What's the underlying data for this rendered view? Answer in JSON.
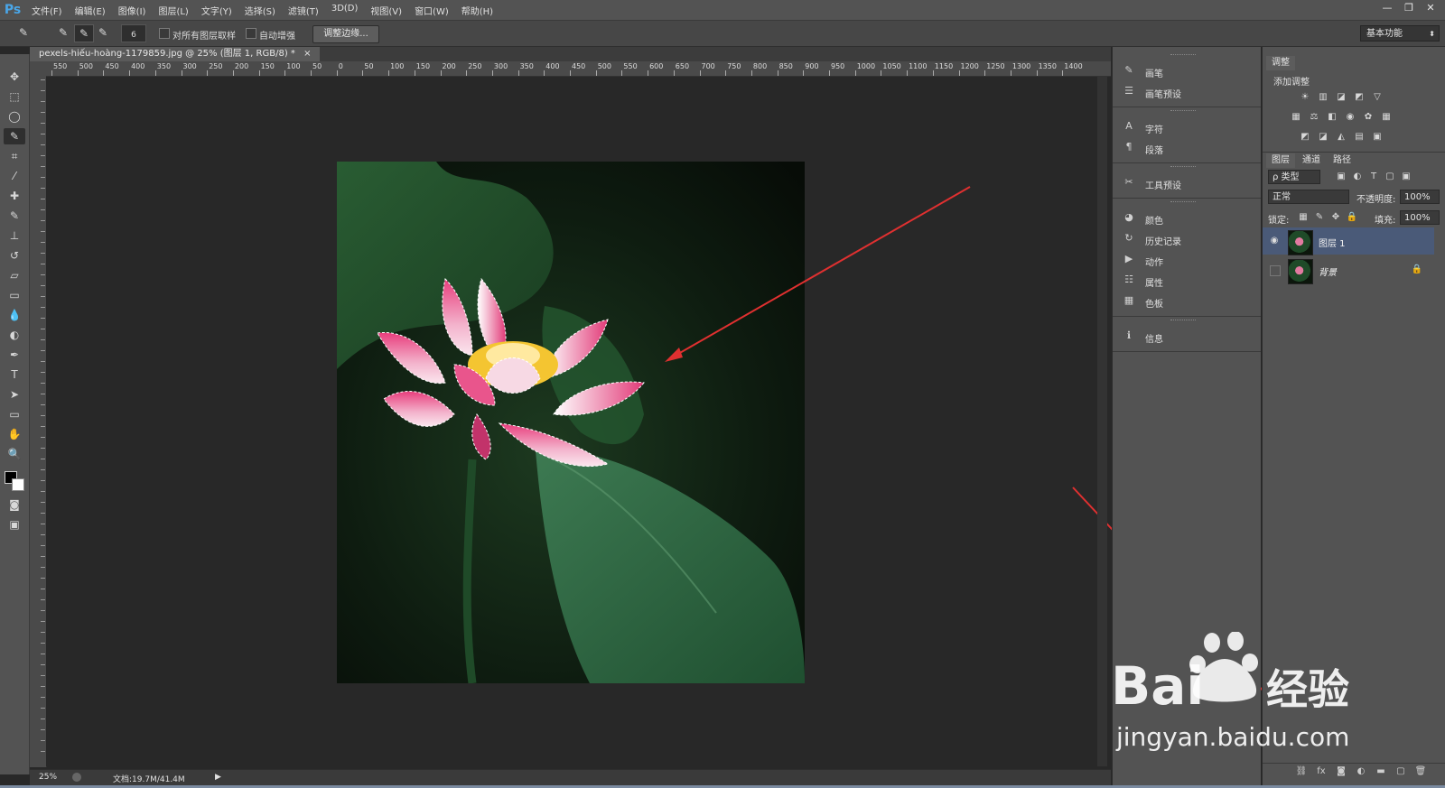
{
  "app": {
    "logo": "Ps",
    "menu": [
      "文件(F)",
      "编辑(E)",
      "图像(I)",
      "图层(L)",
      "文字(Y)",
      "选择(S)",
      "滤镜(T)",
      "3D(D)",
      "视图(V)",
      "窗口(W)",
      "帮助(H)"
    ],
    "window_controls": [
      "—",
      "❐",
      "✕"
    ]
  },
  "options_bar": {
    "brush_size": "6",
    "sample_all_layers": "对所有图层取样",
    "auto_enhance": "自动增强",
    "refine_edge": "调整边缘...",
    "workspace": "基本功能"
  },
  "document": {
    "tab_title": "pexels-hiếu-hoàng-1179859.jpg @ 25% (图层 1, RGB/8) *",
    "tab_close": "×",
    "zoom": "25%",
    "doc_size": "文档:19.7M/41.4M"
  },
  "rulers": {
    "horizontal": [
      "550",
      "500",
      "450",
      "400",
      "350",
      "300",
      "250",
      "200",
      "150",
      "100",
      "50",
      "0",
      "50",
      "100",
      "150",
      "200",
      "250",
      "300",
      "350",
      "400",
      "450",
      "500",
      "550",
      "600",
      "650",
      "700",
      "750",
      "800",
      "850",
      "900",
      "950",
      "1000",
      "1050",
      "1100",
      "1150",
      "1200",
      "1250",
      "1300",
      "1350",
      "1400"
    ]
  },
  "collapsed_panels": {
    "groups": [
      [
        {
          "icon": "brush-icon",
          "label": "画笔"
        },
        {
          "icon": "brush-presets-icon",
          "label": "画笔预设"
        }
      ],
      [
        {
          "icon": "character-icon",
          "label": "字符"
        },
        {
          "icon": "paragraph-icon",
          "label": "段落"
        }
      ],
      [
        {
          "icon": "tool-presets-icon",
          "label": "工具预设"
        }
      ],
      [
        {
          "icon": "color-icon",
          "label": "颜色"
        },
        {
          "icon": "history-icon",
          "label": "历史记录"
        },
        {
          "icon": "actions-icon",
          "label": "动作"
        },
        {
          "icon": "properties-icon",
          "label": "属性"
        },
        {
          "icon": "swatches-icon",
          "label": "色板"
        }
      ],
      [
        {
          "icon": "info-icon",
          "label": "信息"
        }
      ]
    ]
  },
  "adjustments": {
    "tab": "调整",
    "title": "添加调整"
  },
  "layers_panel": {
    "tabs": [
      "图层",
      "通道",
      "路径"
    ],
    "filter": "ρ 类型",
    "blend_mode": "正常",
    "opacity_label": "不透明度:",
    "opacity_value": "100%",
    "lock_label": "锁定:",
    "fill_label": "填充:",
    "fill_value": "100%",
    "layers": [
      {
        "name": "图层 1",
        "visible": true,
        "selected": true
      },
      {
        "name": "背景",
        "visible": false,
        "selected": false,
        "locked": true
      }
    ]
  },
  "watermark": {
    "brand": "Bai",
    "brand_suffix": "经验",
    "url": "jingyan.baidu.com"
  },
  "colors": {
    "ui_dark": "#535353",
    "canvas_bg": "#282828",
    "selected_layer": "#4a5a78",
    "arrow_red": "#e03030"
  }
}
